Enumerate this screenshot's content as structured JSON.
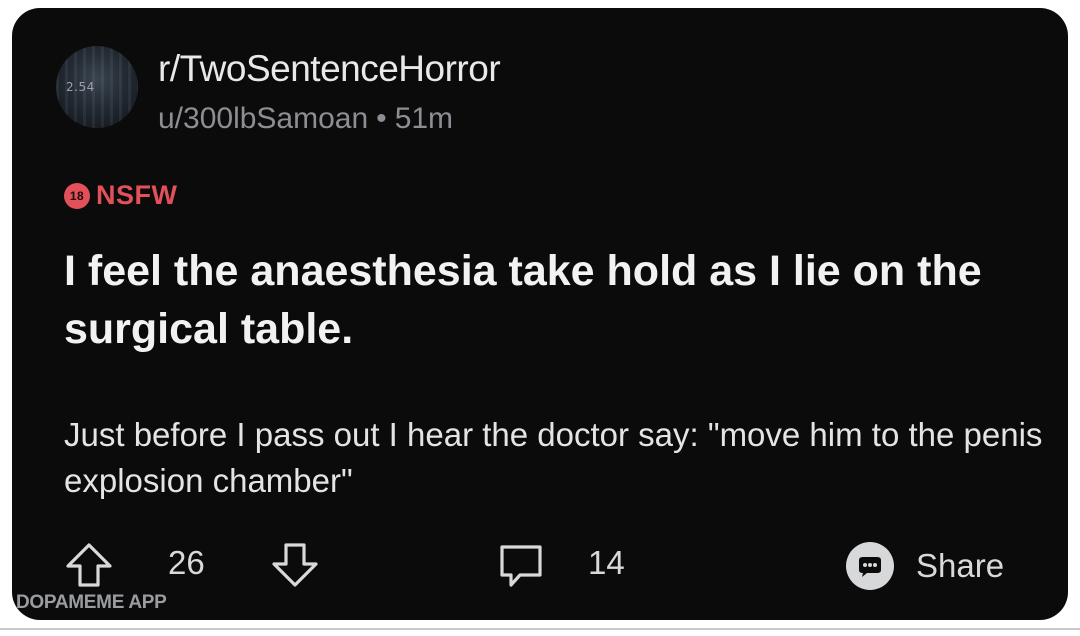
{
  "post": {
    "avatar_tag": "2.54",
    "subreddit": "r/TwoSentenceHorror",
    "author": "u/300lbSamoan",
    "separator": "•",
    "age": "51m",
    "nsfw_badge": "18",
    "nsfw_label": "NSFW",
    "title": "I feel the anaesthesia take hold as I lie on the surgical table.",
    "body": "Just before I pass out I hear the doctor say: \"move him to the penis explosion chamber\""
  },
  "actions": {
    "upvote_icon": "arrow-up-outline-icon",
    "vote_count": "26",
    "downvote_icon": "arrow-down-outline-icon",
    "comment_icon": "speech-bubble-icon",
    "comment_count": "14",
    "share_icon": "share-bubble-icon",
    "share_label": "Share"
  },
  "watermark": "DOPAMEME APP",
  "colors": {
    "background": "#0b0b0c",
    "nsfw": "#e2505a",
    "text_primary": "#f2f2f3",
    "text_secondary": "#8c8e93"
  }
}
